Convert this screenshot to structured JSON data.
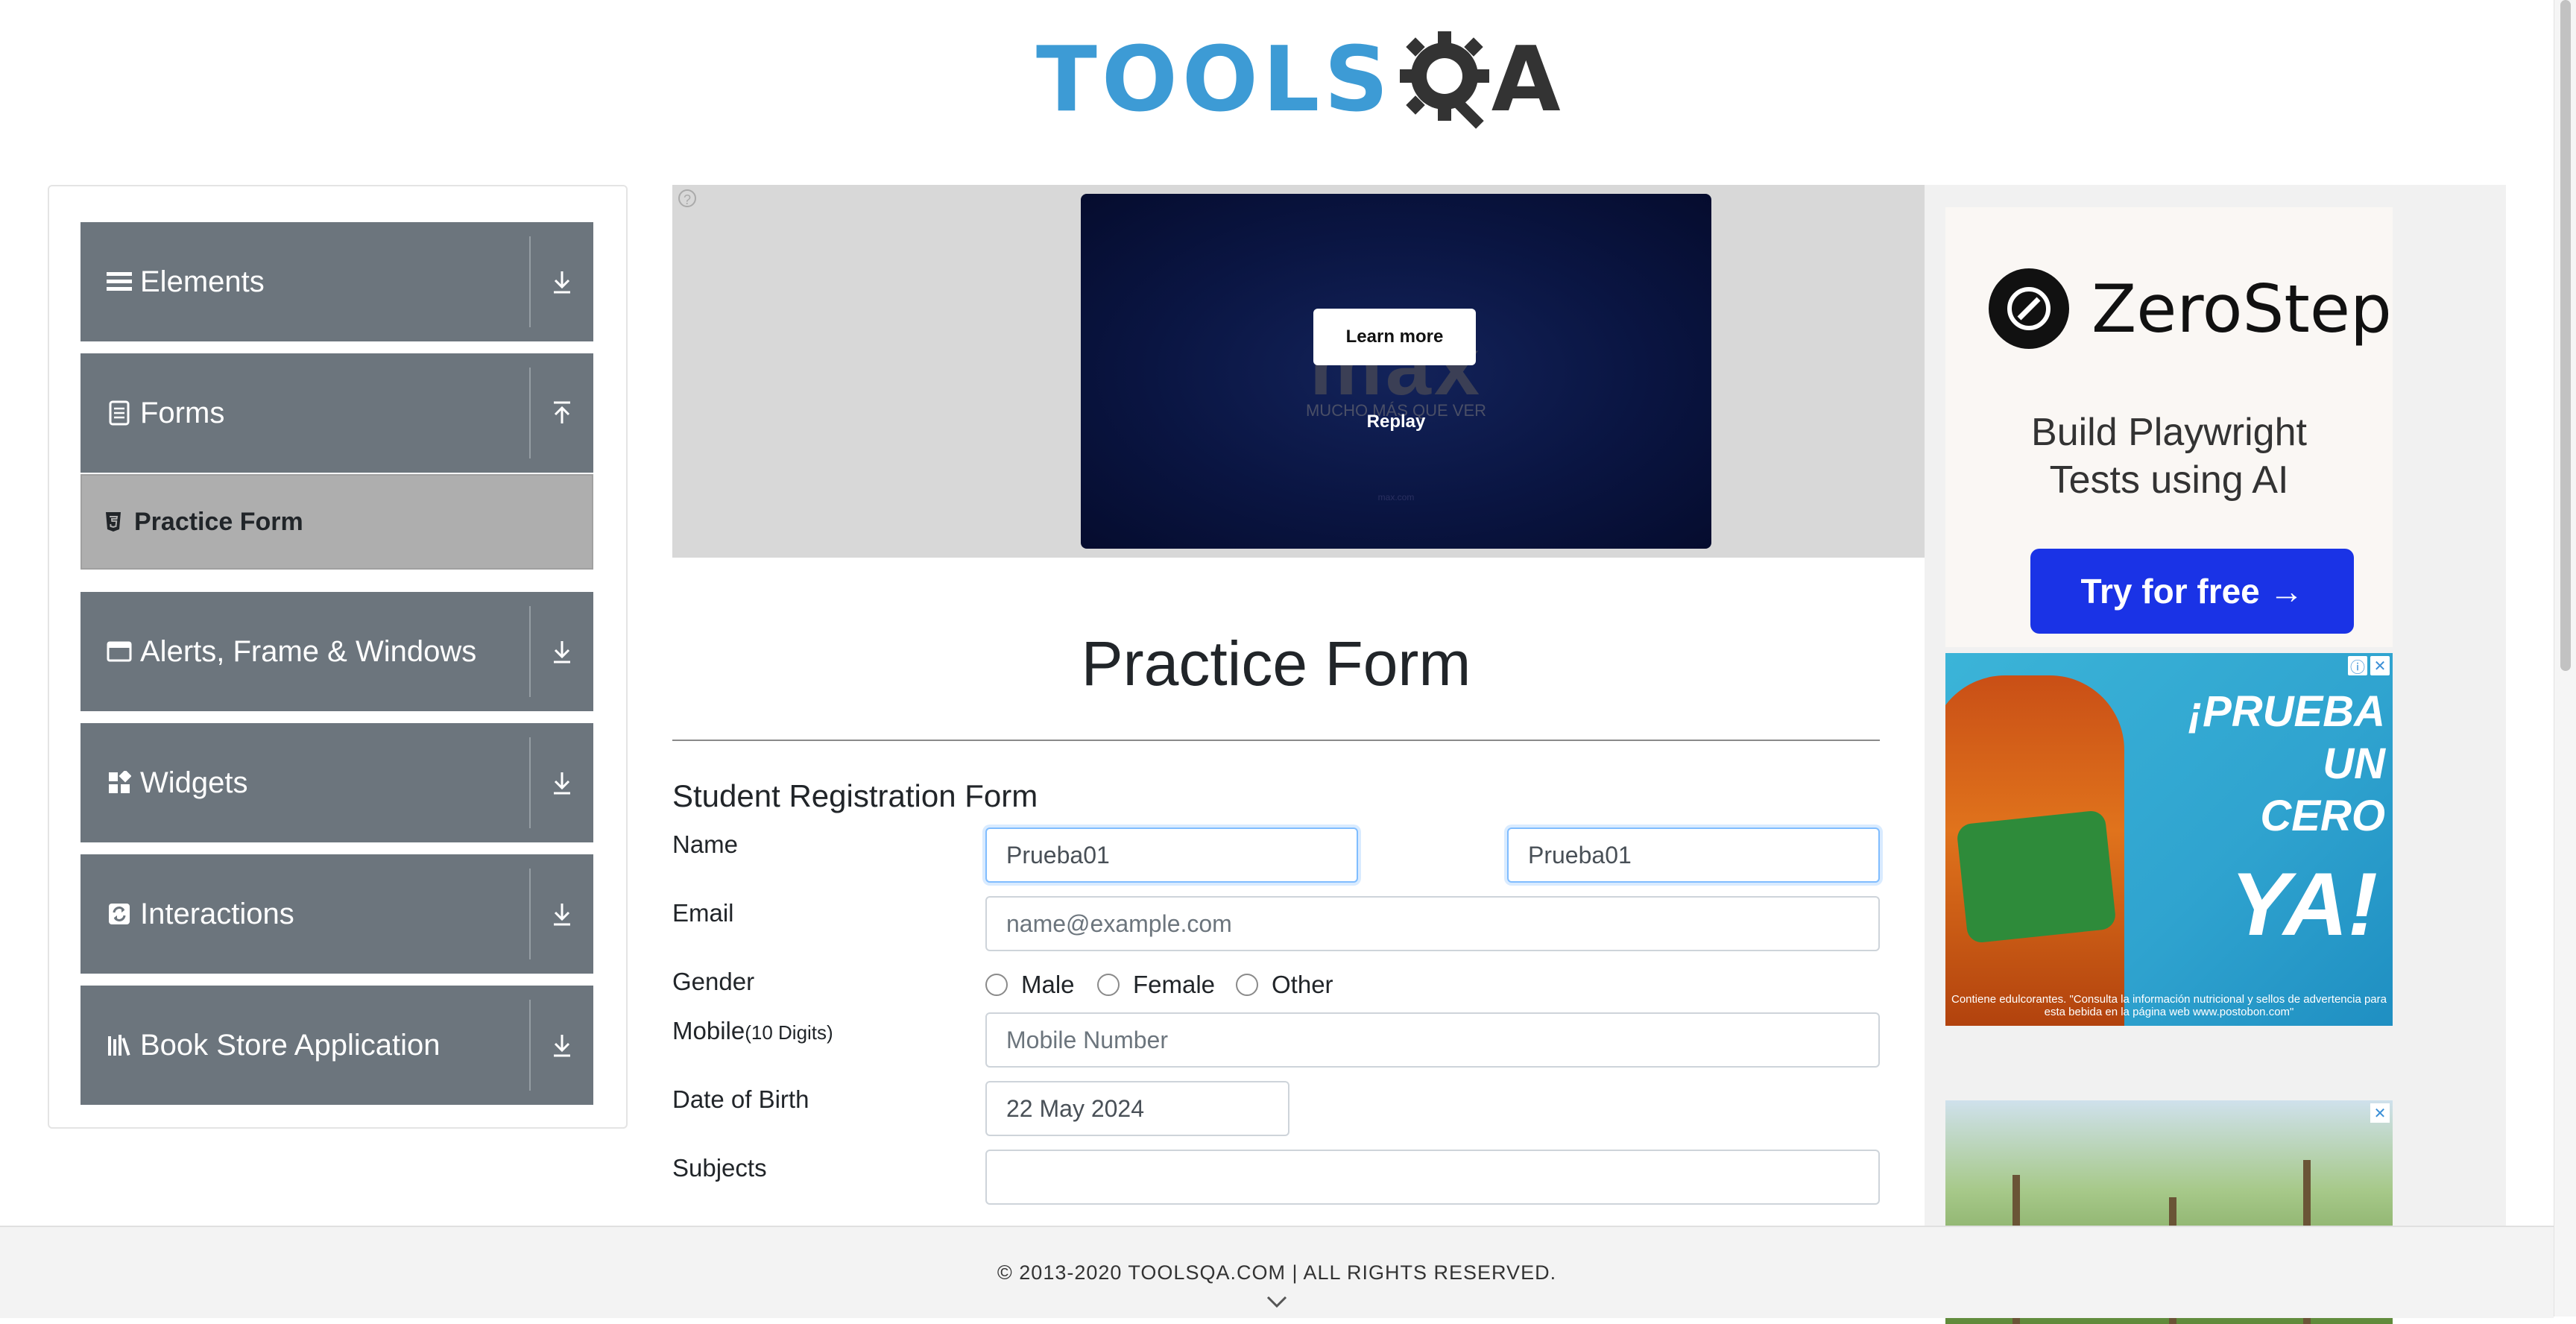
{
  "logo": {
    "left_text": "TOOLS",
    "right_text": "A"
  },
  "sidebar": {
    "groups": [
      {
        "label": "Elements",
        "icon": "hamburger-icon",
        "expanded": false
      },
      {
        "label": "Forms",
        "icon": "document-icon",
        "expanded": true
      },
      {
        "label": "Alerts, Frame & Windows",
        "icon": "window-icon",
        "expanded": false
      },
      {
        "label": "Widgets",
        "icon": "widgets-icon",
        "expanded": false
      },
      {
        "label": "Interactions",
        "icon": "interactions-icon",
        "expanded": false
      },
      {
        "label": "Book Store Application",
        "icon": "books-icon",
        "expanded": false
      }
    ],
    "active_item": {
      "label": "Practice Form",
      "icon": "html5-icon"
    }
  },
  "ad_banner": {
    "brand_text": "max",
    "tagline": "MUCHO MÁS QUE VER",
    "learn_more": "Learn more",
    "replay": "Replay",
    "fine_print": "max.com"
  },
  "main": {
    "page_title": "Practice Form",
    "form_title": "Student Registration Form",
    "name_label": "Name",
    "first_name_value": "Prueba01",
    "last_name_value": "Prueba01",
    "email_label": "Email",
    "email_placeholder": "name@example.com",
    "gender_label": "Gender",
    "gender_options": [
      "Male",
      "Female",
      "Other"
    ],
    "mobile_label": "Mobile",
    "mobile_hint": "(10 Digits)",
    "mobile_placeholder": "Mobile Number",
    "dob_label": "Date of Birth",
    "dob_value": "22 May 2024",
    "subjects_label": "Subjects",
    "subjects_value": ""
  },
  "ads_right": {
    "zerostep_name": "ZeroStep",
    "zerostep_tagline_1": "Build Playwright",
    "zerostep_tagline_2": "Tests using AI",
    "zerostep_cta": "Try for free →",
    "tea_headline": "¡PRUEBA UN",
    "tea_headline_2": "CERO",
    "tea_big": "YA!",
    "tea_disclaimer": "Contiene edulcorantes. \"Consulta la información nutricional y sellos de advertencia para esta bebida en la página web www.postobon.com\""
  },
  "footer": {
    "copyright": "© 2013-2020 TOOLSQA.COM | ALL RIGHTS RESERVED."
  }
}
